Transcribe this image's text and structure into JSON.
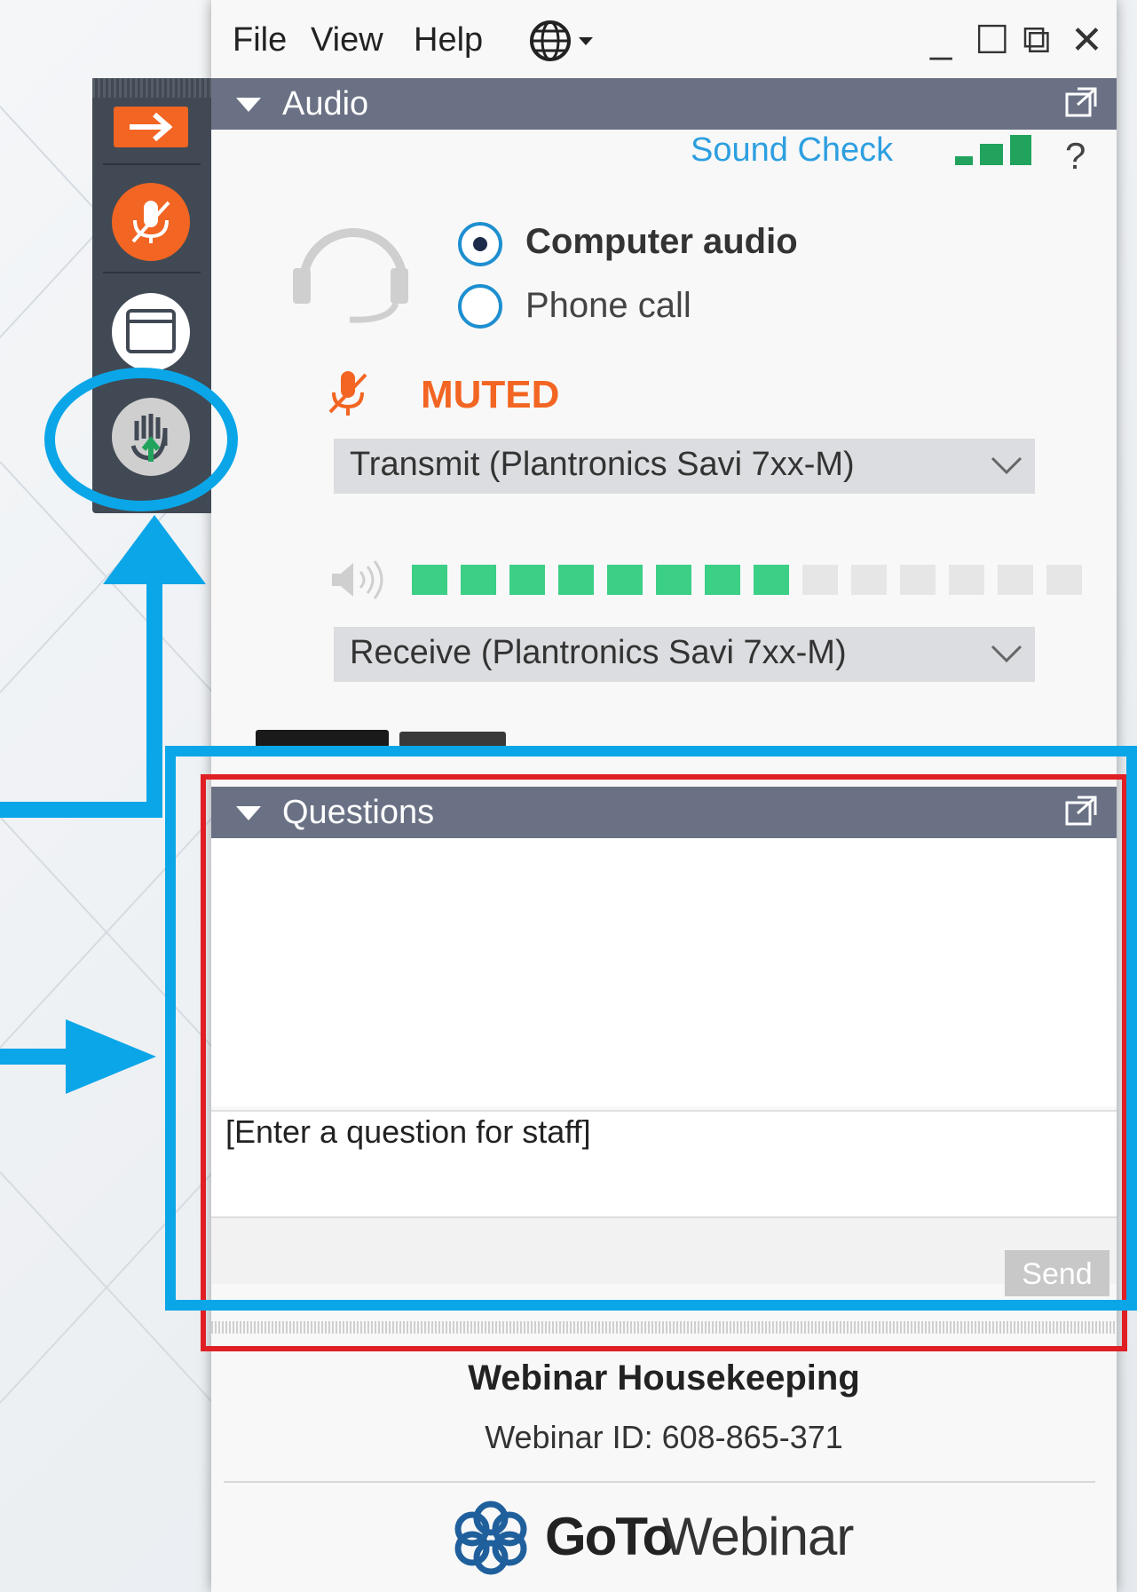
{
  "menu": {
    "file": "File",
    "view": "View",
    "help": "Help"
  },
  "window_controls": {
    "minimize": "_",
    "maximize": "☐",
    "popout": "⧉",
    "close": "✕"
  },
  "audio": {
    "panel_title": "Audio",
    "sound_check": "Sound Check",
    "help": "?",
    "options": [
      {
        "label": "Computer audio",
        "selected": true
      },
      {
        "label": "Phone call",
        "selected": false
      }
    ],
    "mute_status": "MUTED",
    "transmit_device": "Transmit (Plantronics Savi 7xx-M)",
    "receive_device": "Receive (Plantronics Savi 7xx-M)",
    "speaker_level": 0.571
  },
  "questions": {
    "panel_title": "Questions",
    "input_placeholder": "[Enter a question for staff]",
    "send_label": "Send"
  },
  "footer": {
    "title": "Webinar Housekeeping",
    "webinar_id": "Webinar ID: 608-865-371",
    "brand_go": "GoTo",
    "brand_webinar": "Webinar"
  },
  "colors": {
    "accent_blue": "#0aa6e8",
    "muted_orange": "#f26522",
    "level_green": "#3ccf86",
    "header_gray": "#6a7184",
    "highlight_red": "#e01f24"
  }
}
